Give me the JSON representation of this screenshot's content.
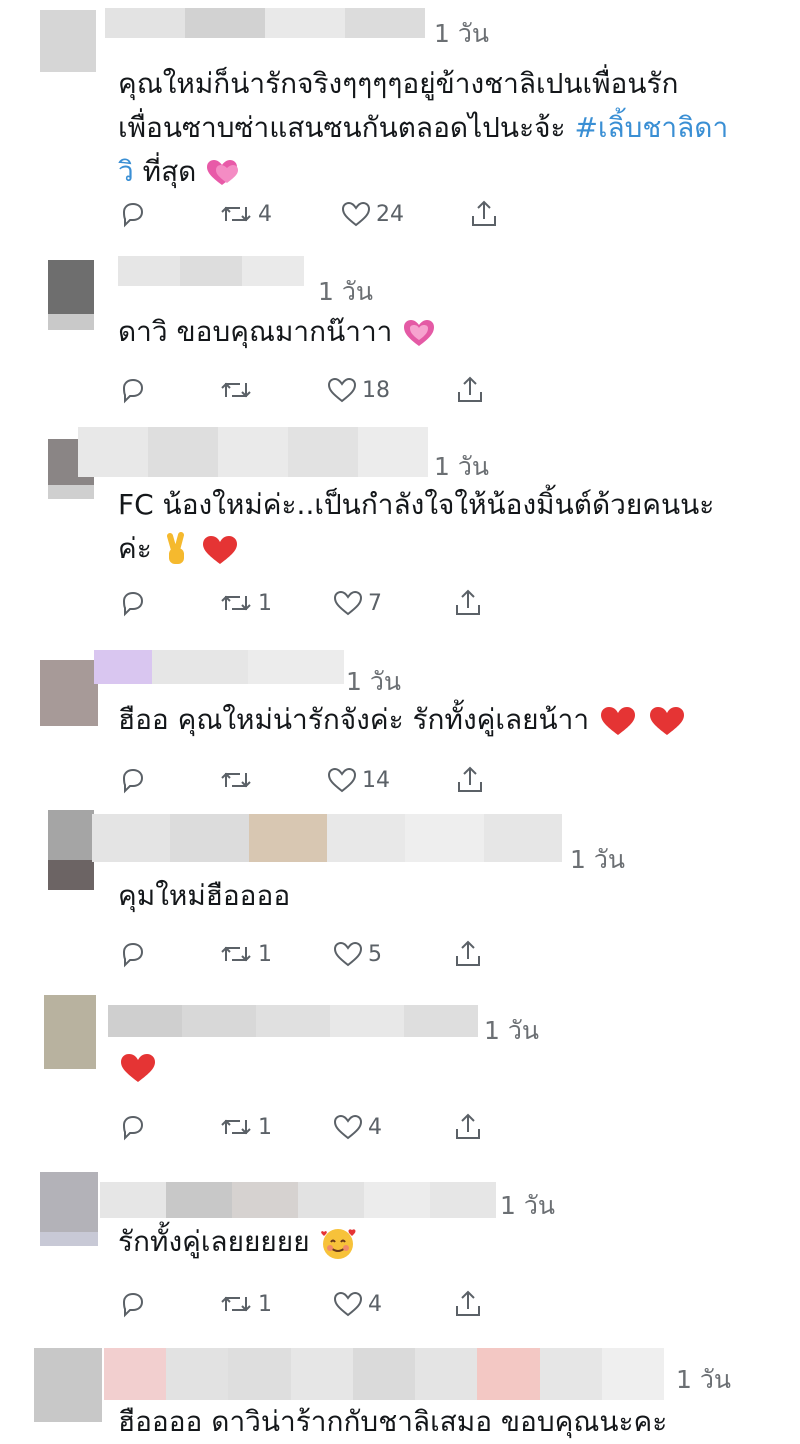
{
  "replies": [
    {
      "meta": "1 วัน",
      "lines": [
        "คุณใหม่ก็น่ารักจริงๆๆๆๆอยู่ข้างชาลิเปนเพื่อนรัก",
        "เพื่อนซาบซ่าแสนซนกันตลอดไปนะจ้ะ "
      ],
      "hashtag": "#เลิ้บชาลิดา",
      "hashtag_cont": "วิ",
      "after": " ที่สุด",
      "emoji": "sparkling-heart",
      "retweets": "4",
      "likes": "24"
    },
    {
      "meta": "1 วัน",
      "text": "ดาวิ ขอบคุณมากน๊าาา",
      "emoji": "pink-heart",
      "retweets": "",
      "likes": "18"
    },
    {
      "meta": "1 วัน",
      "lines": [
        "FC น้องใหม่ค่ะ..เป็นกำลังใจให้น้องมิ้นต์ด้วยคนนะ",
        "ค่ะ"
      ],
      "emoji": "victory-hand + red-heart",
      "retweets": "1",
      "likes": "7"
    },
    {
      "meta": "1 วัน",
      "text": "ฮืออ คุณใหม่น่ารักจังค่ะ รักทั้งคู่เลยน้าา",
      "emoji": "red-heart red-heart",
      "retweets": "",
      "likes": "14"
    },
    {
      "meta": "1 วัน",
      "text": "คุมใหม่ฮืออออ",
      "retweets": "1",
      "likes": "5"
    },
    {
      "meta": "1 วัน",
      "emoji": "red-heart",
      "retweets": "1",
      "likes": "4"
    },
    {
      "meta": "1 วัน",
      "text": "รักทั้งคู่เลยยยยย",
      "emoji": "smiling-face-with-hearts",
      "retweets": "1",
      "likes": "4"
    },
    {
      "meta": "1 วัน",
      "text": "ฮืออออ ดาวิน่าร้ากกับชาลิเสมอ ขอบคุณนะคะ"
    }
  ],
  "colors": {
    "hashtag": "#3a8fd4",
    "icon": "#5b6167",
    "text": "#14171a"
  }
}
